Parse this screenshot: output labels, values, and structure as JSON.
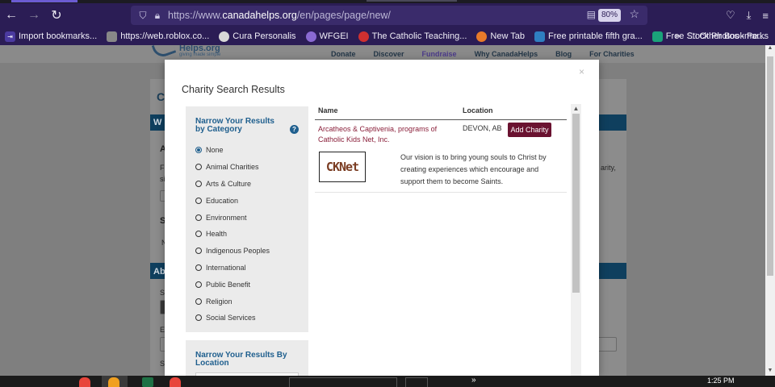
{
  "browser": {
    "url_prefix": "https://www.",
    "url_host": "canadahelps.org",
    "url_path": "/en/pages/page/new/",
    "zoom": "80%"
  },
  "bookmarks": [
    {
      "label": "Import bookmarks...",
      "color": "#4b3aa0"
    },
    {
      "label": "https://web.roblox.co...",
      "color": "#888888"
    },
    {
      "label": "Cura Personalis",
      "color": "#d8d8d8"
    },
    {
      "label": "WFGEI",
      "color": "#8a6ad2"
    },
    {
      "label": "The Catholic Teaching...",
      "color": "#d03030"
    },
    {
      "label": "New Tab",
      "color": "#e87a2a"
    },
    {
      "label": "Free printable fifth gra...",
      "color": "#2f7fc1"
    },
    {
      "label": "Free Stock Photos - Pe...",
      "color": "#1aa37a"
    }
  ],
  "bookmarks_other": "Other Bookmarks",
  "site": {
    "logo_text": "Helps.org",
    "logo_sub": "giving made simple",
    "nav": [
      "Donate",
      "Discover",
      "Fundraise",
      "Why CanadaHelps",
      "Blog",
      "For Charities"
    ]
  },
  "modal": {
    "title": "Charity Search Results",
    "close": "×",
    "category_heading": "Narrow Your Results by Category",
    "categories": [
      "None",
      "Animal Charities",
      "Arts & Culture",
      "Education",
      "Environment",
      "Health",
      "Indigenous Peoples",
      "International",
      "Public Benefit",
      "Religion",
      "Social Services"
    ],
    "selected_category": "None",
    "location_heading": "Narrow Your Results By Location",
    "columns": {
      "name": "Name",
      "location": "Location"
    },
    "result": {
      "name": "Arcatheos & Captivenia, programs of Catholic Kids Net, Inc.",
      "location": "DEVON, AB",
      "button": "Add Charity",
      "logo_text": "CKNet",
      "description": "Our vision is to bring young souls to Christ by creating experiences which encourage and support them to become Saints."
    }
  },
  "taskbar": {
    "time": "1:25 PM",
    "chevron": "»"
  }
}
